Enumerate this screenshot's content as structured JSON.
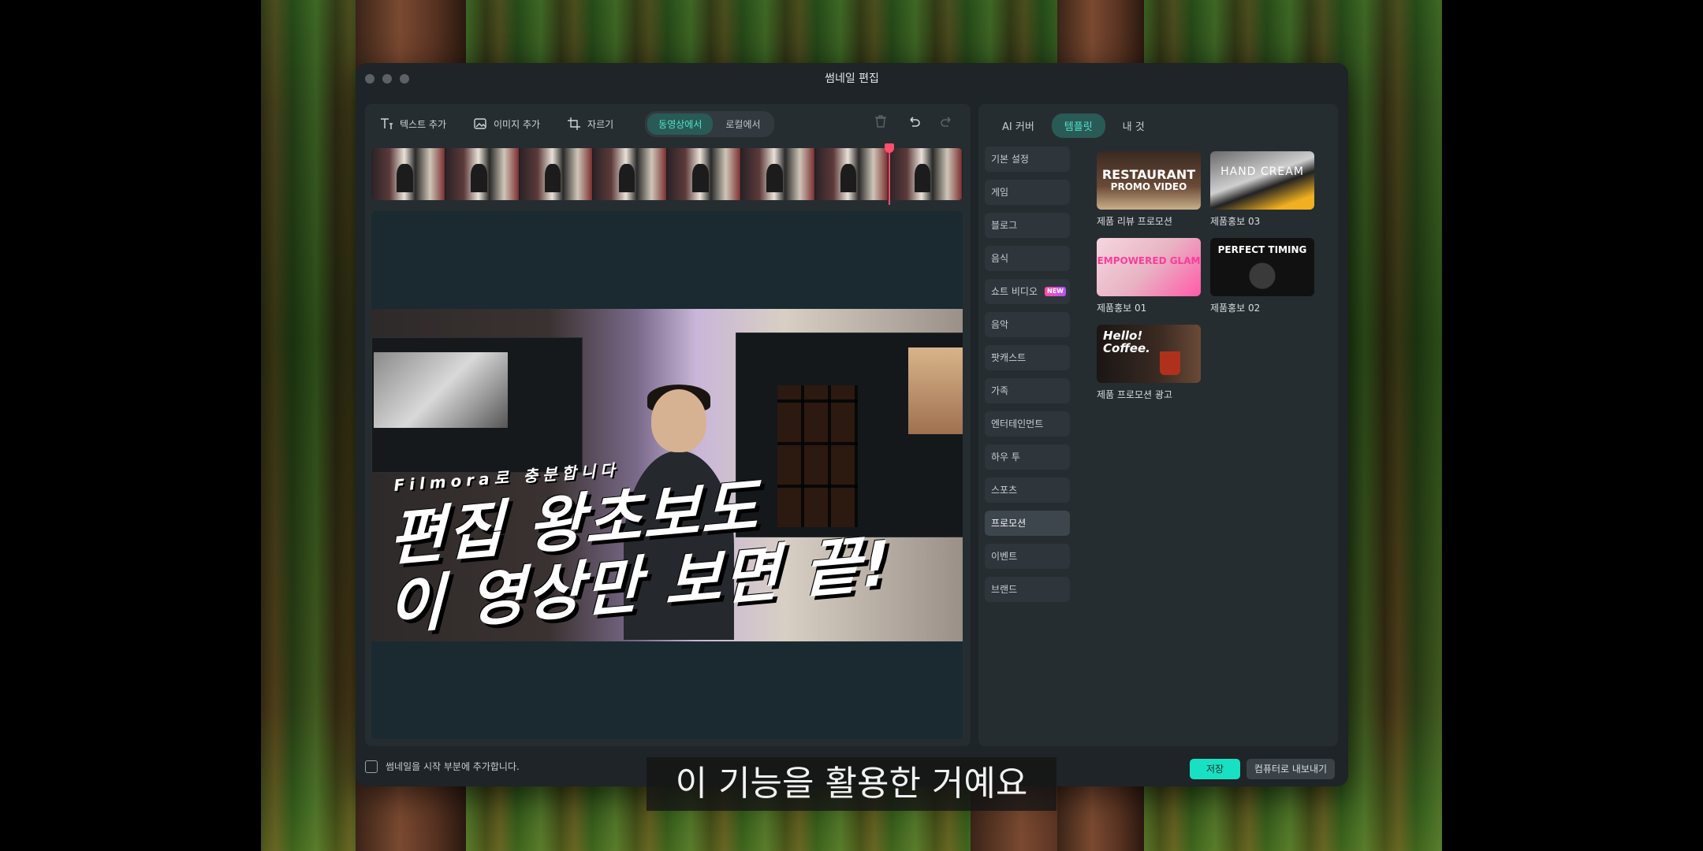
{
  "window": {
    "title": "썸네일 편집"
  },
  "toolbar": {
    "add_text": "텍스트 추가",
    "add_image": "이미지 추가",
    "crop": "자르기",
    "source_tabs": [
      {
        "label": "동영상에서",
        "active": true
      },
      {
        "label": "로컬에서",
        "active": false
      }
    ]
  },
  "thumbnail": {
    "small_text": "Filmora로 충분합니다",
    "big_line1": "편집 왕초보도",
    "big_line2": "이 영상만 보면 끝!"
  },
  "right_tabs": [
    {
      "label": "AI 커버",
      "active": false
    },
    {
      "label": "템플릿",
      "active": true
    },
    {
      "label": "내 것",
      "active": false
    }
  ],
  "categories": [
    {
      "label": "기본 설정"
    },
    {
      "label": "게임"
    },
    {
      "label": "블로그"
    },
    {
      "label": "음식"
    },
    {
      "label": "쇼트 비디오",
      "badge": "NEW"
    },
    {
      "label": "음악"
    },
    {
      "label": "팟캐스트"
    },
    {
      "label": "가족"
    },
    {
      "label": "엔터테인먼트"
    },
    {
      "label": "하우 투"
    },
    {
      "label": "스포츠"
    },
    {
      "label": "프로모션",
      "active": true
    },
    {
      "label": "이벤트"
    },
    {
      "label": "브랜드"
    }
  ],
  "templates": [
    {
      "label": "제품 리뷰 프로모션",
      "img_text1": "RESTAURANT",
      "img_text2": "PROMO VIDEO"
    },
    {
      "label": "제품홍보 03",
      "img_text1": "HAND CREAM"
    },
    {
      "label": "제품홍보 01",
      "img_text1": "EMPOWERED GLAM"
    },
    {
      "label": "제품홍보 02",
      "img_text1": "PERFECT TIMING"
    },
    {
      "label": "제품 프로모션 광고",
      "img_text1": "Hello!",
      "img_text2": "Coffee."
    }
  ],
  "bottom": {
    "checkbox_label": "썸네일을 시작 부분에 추가합니다.",
    "save": "저장",
    "export": "컴퓨터로 내보내기"
  },
  "subtitle": "이 기능을 활용한 거예요",
  "colors": {
    "accent": "#18e0c2",
    "playhead": "#ff4d6a"
  }
}
